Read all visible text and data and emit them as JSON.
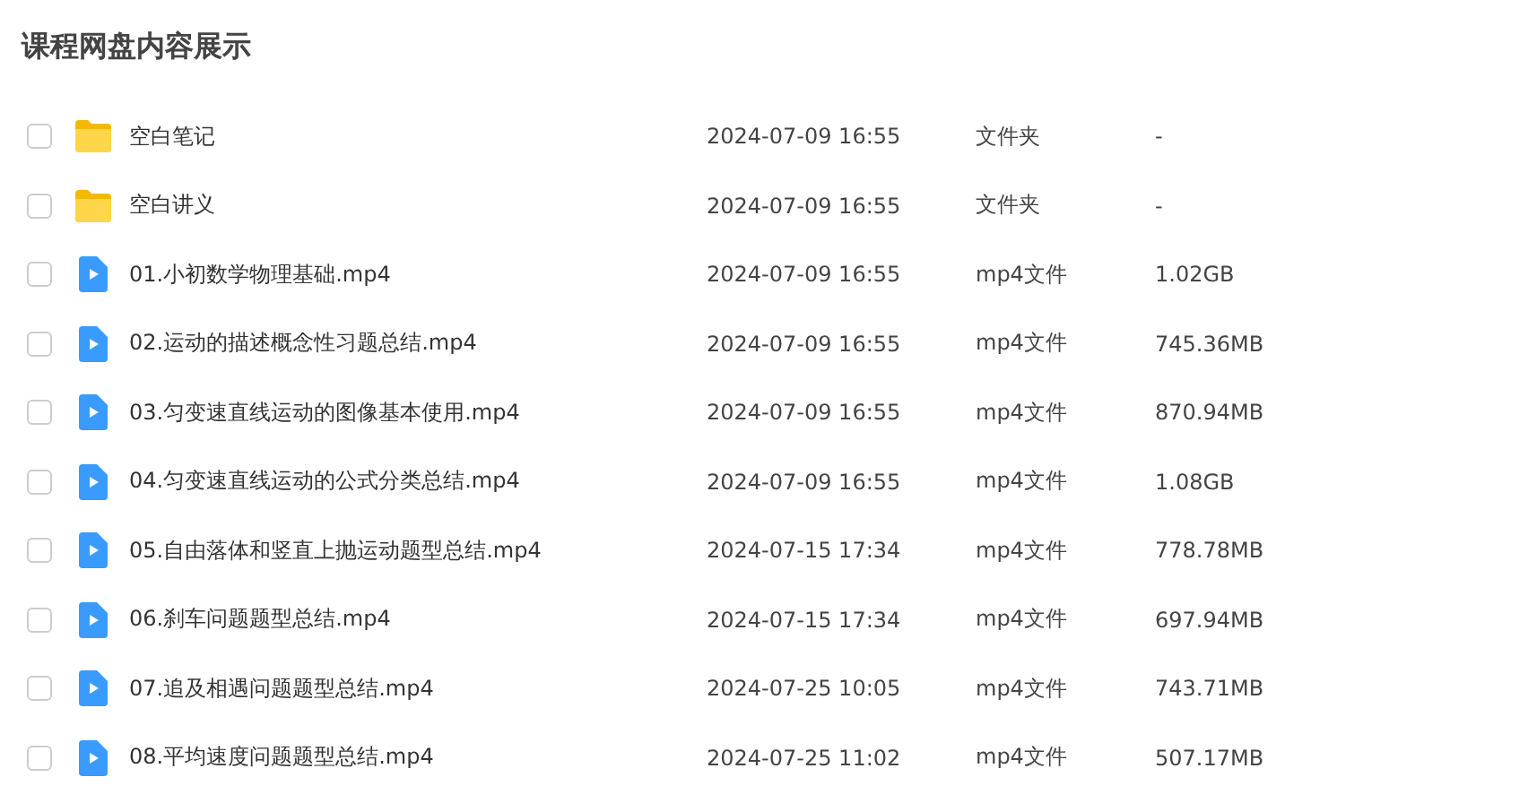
{
  "title": "课程网盘内容展示",
  "files": [
    {
      "kind": "folder",
      "name": "空白笔记",
      "date": "2024-07-09 16:55",
      "type": "文件夹",
      "size": "-",
      "checked": false
    },
    {
      "kind": "folder",
      "name": "空白讲义",
      "date": "2024-07-09 16:55",
      "type": "文件夹",
      "size": "-",
      "checked": false
    },
    {
      "kind": "video",
      "name": "01.小初数学物理基础.mp4",
      "date": "2024-07-09 16:55",
      "type": "mp4文件",
      "size": "1.02GB",
      "checked": false
    },
    {
      "kind": "video",
      "name": "02.运动的描述概念性习题总结.mp4",
      "date": "2024-07-09 16:55",
      "type": "mp4文件",
      "size": "745.36MB",
      "checked": false
    },
    {
      "kind": "video",
      "name": "03.匀变速直线运动的图像基本使用.mp4",
      "date": "2024-07-09 16:55",
      "type": "mp4文件",
      "size": "870.94MB",
      "checked": false
    },
    {
      "kind": "video",
      "name": "04.匀变速直线运动的公式分类总结.mp4",
      "date": "2024-07-09 16:55",
      "type": "mp4文件",
      "size": "1.08GB",
      "checked": false
    },
    {
      "kind": "video",
      "name": "05.自由落体和竖直上抛运动题型总结.mp4",
      "date": "2024-07-15 17:34",
      "type": "mp4文件",
      "size": "778.78MB",
      "checked": false
    },
    {
      "kind": "video",
      "name": "06.刹车问题题型总结.mp4",
      "date": "2024-07-15 17:34",
      "type": "mp4文件",
      "size": "697.94MB",
      "checked": false
    },
    {
      "kind": "video",
      "name": "07.追及相遇问题题型总结.mp4",
      "date": "2024-07-25 10:05",
      "type": "mp4文件",
      "size": "743.71MB",
      "checked": false
    },
    {
      "kind": "video",
      "name": "08.平均速度问题题型总结.mp4",
      "date": "2024-07-25 11:02",
      "type": "mp4文件",
      "size": "507.17MB",
      "checked": false
    }
  ]
}
